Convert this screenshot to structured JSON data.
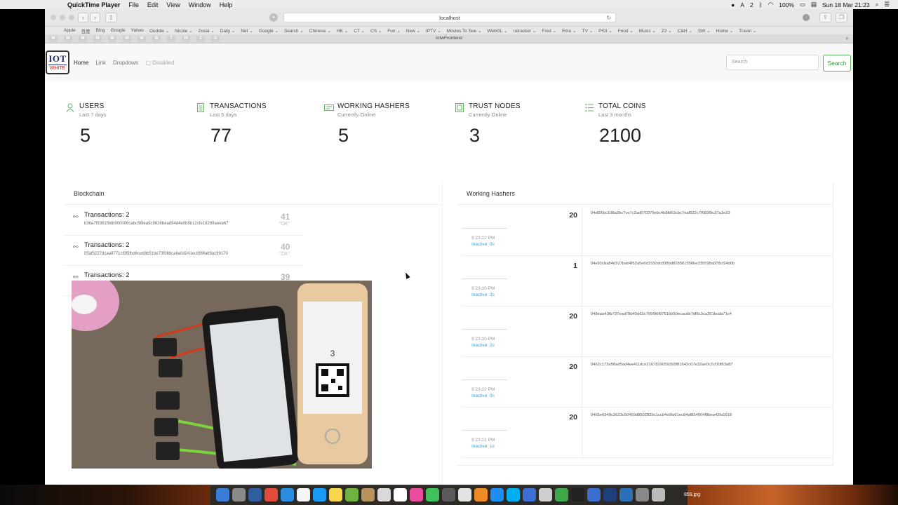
{
  "menubar": {
    "app_name": "QuickTime Player",
    "items": [
      "File",
      "Edit",
      "View",
      "Window",
      "Help"
    ],
    "status": {
      "battery": "100%",
      "datetime": "Sun 18 Mar  21:23",
      "notif_count": "2"
    }
  },
  "browser": {
    "url": "localhost",
    "tab_title": "IotwFrontend",
    "bookmarks": [
      "Apple",
      "百度",
      "Bing",
      "Google",
      "Yahoo",
      "Ouddle ⌄",
      "Nicole ⌄",
      "Zosia ⌄",
      "Daily ⌄",
      "Net ⌄",
      "Google ⌄",
      "Search ⌄",
      "Chinese ⌄",
      "HK ⌄",
      "CT ⌄",
      "CS ⌄",
      "Fun ⌄",
      "New ⌄",
      "IPTV ⌄",
      "Movies To See ⌄",
      "WebGL ⌄",
      "rutracker ⌄",
      "Fred ⌄",
      "Emu ⌄",
      "TV ⌄",
      "PS3 ⌄",
      "Food ⌄",
      "Music ⌄",
      "Z2 ⌄",
      "C&H ⌄",
      "SW ⌄",
      "Home ⌄",
      "Travel ⌄"
    ],
    "tab_icons": [
      "M",
      "M",
      "M",
      "M",
      "M",
      "W",
      "W",
      "B",
      "T",
      "N",
      "Z",
      "O"
    ]
  },
  "app": {
    "logo": {
      "line1": "IOT",
      "line2": "WHITE"
    },
    "nav": {
      "home": "Home",
      "link": "Link",
      "dropdown": "Dropdown",
      "disabled": "Disabled"
    },
    "search": {
      "placeholder": "Search",
      "button": "Search"
    }
  },
  "stats": [
    {
      "title": "USERS",
      "sub": "Last 7 days",
      "value": "5"
    },
    {
      "title": "TRANSACTIONS",
      "sub": "Last 5 days",
      "value": "77"
    },
    {
      "title": "WORKING HASHERS",
      "sub": "Currently Online",
      "value": "5"
    },
    {
      "title": "TRUST NODES",
      "sub": "Currently Online",
      "value": "3"
    },
    {
      "title": "TOTAL COINS",
      "sub": "Last 3 months",
      "value": "2100"
    }
  ],
  "accent_color": "#5cb85c",
  "blockchain": {
    "title": "Blockchain",
    "blocks": [
      {
        "tx": "Transactions: 2",
        "hash": "b36a7f9391f9db900006cabcf89ea5c9626bead54d4e0b5b12cfe18289aeea67",
        "num": "41",
        "status": "\"OK\""
      },
      {
        "tx": "Transactions: 2",
        "hash": "05af5227dcaa9771c695fbd6ceb8b51be73f086ca9a0d241ec899fa89ac99170",
        "num": "40",
        "status": "\"OK\""
      },
      {
        "tx": "Transactions: 2",
        "hash": "",
        "num": "39",
        "status": ""
      }
    ]
  },
  "hashers": {
    "title": "Working Hashers",
    "rows": [
      {
        "count": "20",
        "key": "04df26bc108a2bc7ce7c2ad670379ebc4b8fd63cbc7eaf522c7f683f9c37a1e23",
        "time": "9:23:22 PM",
        "inactive": "Inactive: 0s"
      },
      {
        "count": "1",
        "key": "04e92cba84d107bab4f62a5e6d1550dc838bd828561556be335598a978cf24d0b",
        "time": "9:23:20 PM",
        "inactive": "Inactive: 2s"
      },
      {
        "count": "20",
        "key": "048eaa43fb737ead78d40d62c795f96f87616b50ecacdb7df8c3ca361bcda71c4",
        "time": "9:23:20 PM",
        "inactive": "Inactive: 2s"
      },
      {
        "count": "20",
        "key": "0462c173a58ad5ad4ee411dce2167829059393f81642c67e32ae0c2cf10f63a87",
        "time": "9:23:22 PM",
        "inactive": "Inactive: 0s"
      },
      {
        "count": "20",
        "key": "0465e6949c2623c50469d8502829c1ccb4e9fa61ec84af854064f8bea42fa1618",
        "time": "9:23:21 PM",
        "inactive": "Inactive: 1s"
      }
    ]
  },
  "video_overlay": {
    "phone_number": "3"
  },
  "dock": {
    "file_label": "859.jpg"
  }
}
